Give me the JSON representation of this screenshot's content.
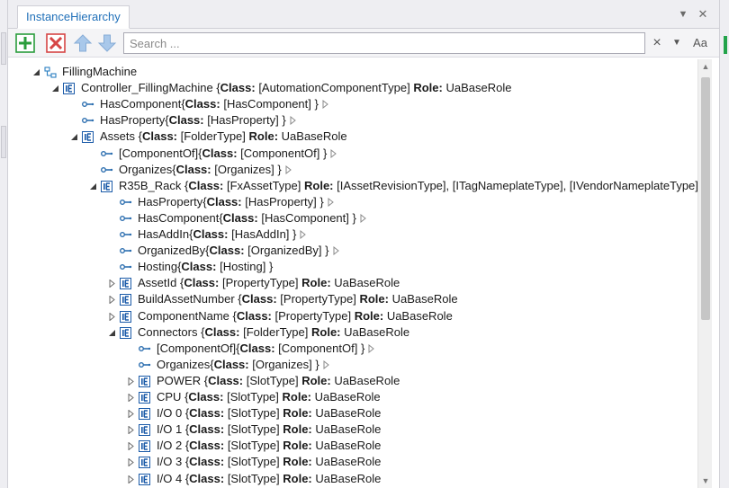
{
  "tab": {
    "title": "InstanceHierarchy"
  },
  "window_controls": {
    "dropdown_glyph": "▼",
    "close_glyph": "✕"
  },
  "toolbar": {
    "buttons": [
      {
        "name": "add-button",
        "icon": "green-plus-icon",
        "color": "#2a9d3c"
      },
      {
        "name": "delete-button",
        "icon": "red-x-icon",
        "color": "#d64545"
      },
      {
        "name": "move-up-button",
        "icon": "arrow-up-icon",
        "color": "#a9c8ea"
      },
      {
        "name": "move-down-button",
        "icon": "arrow-down-icon",
        "color": "#a9c8ea"
      }
    ],
    "search_placeholder": "Search ...",
    "clear_glyph": "×",
    "dropdown_glyph": "▼",
    "match_case_label": "Aa"
  },
  "colors": {
    "accent": "#1f6fb8",
    "ie_icon": "#1a5aa8",
    "link_icon": "#2d6fb0"
  },
  "tree": [
    {
      "depth": 0,
      "expander": "expanded",
      "icon": "hierarchy-icon",
      "name": "FillingMachine"
    },
    {
      "depth": 1,
      "expander": "expanded",
      "icon": "ie-icon",
      "name": "Controller_FillingMachine",
      "cls": "[AutomationComponentType]",
      "role": "UaBaseRole"
    },
    {
      "depth": 2,
      "expander": "none",
      "icon": "link-icon",
      "name": "HasComponent",
      "cls": "[HasComponent]",
      "relation": true
    },
    {
      "depth": 2,
      "expander": "none",
      "icon": "link-icon",
      "name": "HasProperty",
      "cls": "[HasProperty]",
      "relation": true
    },
    {
      "depth": 2,
      "expander": "expanded",
      "icon": "ie-icon",
      "name": "Assets",
      "cls": "[FolderType]",
      "role": "UaBaseRole"
    },
    {
      "depth": 3,
      "expander": "none",
      "icon": "link-icon",
      "name": "[ComponentOf]",
      "cls": "[ComponentOf]",
      "relation": true
    },
    {
      "depth": 3,
      "expander": "none",
      "icon": "link-icon",
      "name": "Organizes",
      "cls": "[Organizes]",
      "relation": true
    },
    {
      "depth": 3,
      "expander": "expanded",
      "icon": "ie-icon",
      "name": "R35B_Rack",
      "cls": "[FxAssetType]",
      "role": "[IAssetRevisionType], [ITagNameplateType], [IVendorNameplateType]",
      "role_close": "}"
    },
    {
      "depth": 4,
      "expander": "none",
      "icon": "link-icon",
      "name": "HasProperty",
      "cls": "[HasProperty]",
      "relation": true
    },
    {
      "depth": 4,
      "expander": "none",
      "icon": "link-icon",
      "name": "HasComponent",
      "cls": "[HasComponent]",
      "relation": true
    },
    {
      "depth": 4,
      "expander": "none",
      "icon": "link-icon",
      "name": "HasAddIn",
      "cls": "[HasAddIn]",
      "relation": true
    },
    {
      "depth": 4,
      "expander": "none",
      "icon": "link-icon",
      "name": "OrganizedBy",
      "cls": "[OrganizedBy]",
      "relation": true
    },
    {
      "depth": 4,
      "expander": "none",
      "icon": "link-icon",
      "name": "Hosting",
      "cls": "[Hosting]",
      "relation": true,
      "no_tail": true
    },
    {
      "depth": 4,
      "expander": "collapsed",
      "icon": "ie-icon",
      "name": "AssetId",
      "cls": "[PropertyType]",
      "role": "UaBaseRole"
    },
    {
      "depth": 4,
      "expander": "collapsed",
      "icon": "ie-icon",
      "name": "BuildAssetNumber",
      "cls": "[PropertyType]",
      "role": "UaBaseRole"
    },
    {
      "depth": 4,
      "expander": "collapsed",
      "icon": "ie-icon",
      "name": "ComponentName",
      "cls": "[PropertyType]",
      "role": "UaBaseRole"
    },
    {
      "depth": 4,
      "expander": "expanded",
      "icon": "ie-icon",
      "name": "Connectors",
      "cls": "[FolderType]",
      "role": "UaBaseRole"
    },
    {
      "depth": 5,
      "expander": "none",
      "icon": "link-icon",
      "name": "[ComponentOf]",
      "cls": "[ComponentOf]",
      "relation": true
    },
    {
      "depth": 5,
      "expander": "none",
      "icon": "link-icon",
      "name": "Organizes",
      "cls": "[Organizes]",
      "relation": true
    },
    {
      "depth": 5,
      "expander": "collapsed",
      "icon": "ie-icon",
      "name": "POWER",
      "cls": "[SlotType]",
      "role": "UaBaseRole"
    },
    {
      "depth": 5,
      "expander": "collapsed",
      "icon": "ie-icon",
      "name": "CPU",
      "cls": "[SlotType]",
      "role": "UaBaseRole"
    },
    {
      "depth": 5,
      "expander": "collapsed",
      "icon": "ie-icon",
      "name": "I/O 0",
      "cls": "[SlotType]",
      "role": "UaBaseRole"
    },
    {
      "depth": 5,
      "expander": "collapsed",
      "icon": "ie-icon",
      "name": "I/O 1",
      "cls": "[SlotType]",
      "role": "UaBaseRole"
    },
    {
      "depth": 5,
      "expander": "collapsed",
      "icon": "ie-icon",
      "name": "I/O 2",
      "cls": "[SlotType]",
      "role": "UaBaseRole"
    },
    {
      "depth": 5,
      "expander": "collapsed",
      "icon": "ie-icon",
      "name": "I/O 3",
      "cls": "[SlotType]",
      "role": "UaBaseRole"
    },
    {
      "depth": 5,
      "expander": "collapsed",
      "icon": "ie-icon",
      "name": "I/O 4",
      "cls": "[SlotType]",
      "role": "UaBaseRole"
    }
  ],
  "labels": {
    "class_key": "Class:",
    "role_key": "Role:",
    "open_brace": "{",
    "close_brace": "}"
  }
}
